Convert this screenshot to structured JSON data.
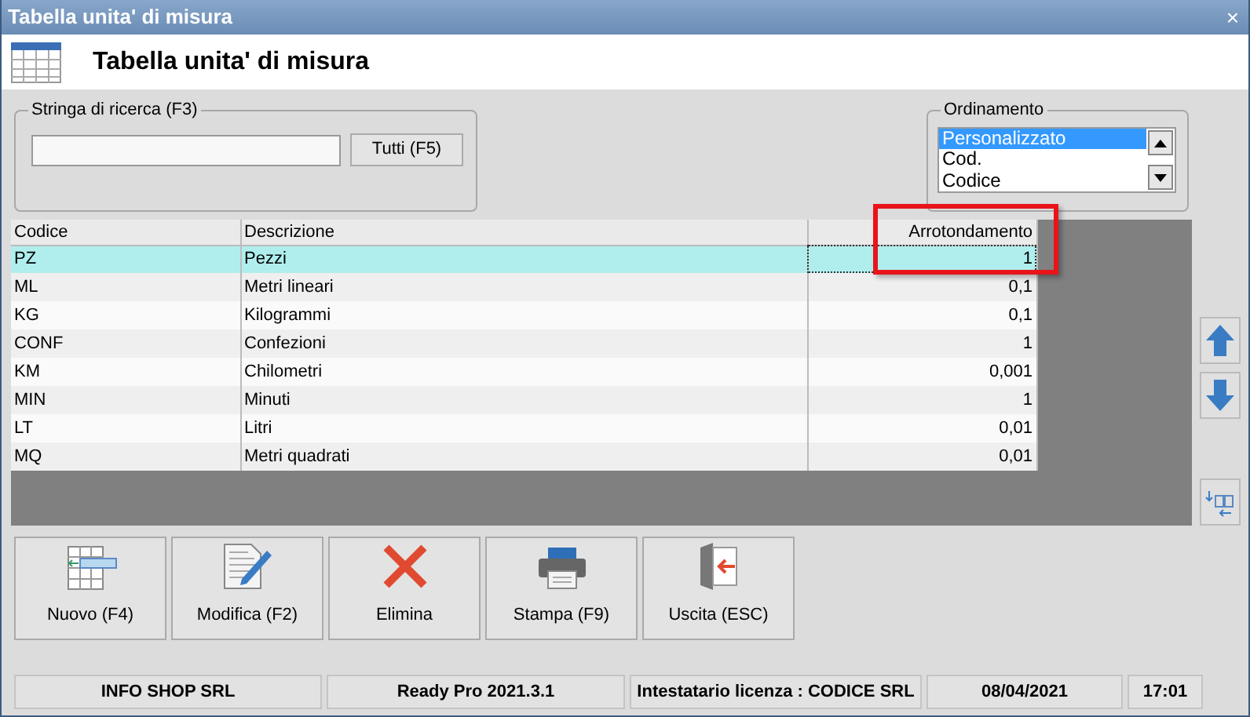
{
  "window": {
    "title": "Tabella unita' di misura",
    "close": "×"
  },
  "header": {
    "title": "Tabella unita' di misura"
  },
  "search": {
    "legend": "Stringa di ricerca (F3)",
    "button": "Tutti (F5)"
  },
  "ordering": {
    "legend": "Ordinamento",
    "options": [
      {
        "label": "Personalizzato",
        "selected": true
      },
      {
        "label": "Cod.",
        "selected": false
      },
      {
        "label": "Codice",
        "selected": false
      }
    ]
  },
  "table": {
    "columns": [
      "Codice",
      "Descrizione",
      "Arrotondamento"
    ],
    "rows": [
      {
        "cells": [
          "PZ",
          "Pezzi",
          "1"
        ],
        "selected": true
      },
      {
        "cells": [
          "ML",
          "Metri lineari",
          "0,1"
        ],
        "selected": false
      },
      {
        "cells": [
          "KG",
          "Kilogrammi",
          "0,1"
        ],
        "selected": false
      },
      {
        "cells": [
          "CONF",
          "Confezioni",
          "1"
        ],
        "selected": false
      },
      {
        "cells": [
          "KM",
          "Chilometri",
          "0,001"
        ],
        "selected": false
      },
      {
        "cells": [
          "MIN",
          "Minuti",
          "1"
        ],
        "selected": false
      },
      {
        "cells": [
          "LT",
          "Litri",
          "0,01"
        ],
        "selected": false
      },
      {
        "cells": [
          "MQ",
          "Metri quadrati",
          "0,01"
        ],
        "selected": false
      }
    ]
  },
  "toolbar": [
    {
      "label": "Nuovo (F4)",
      "kind": "new"
    },
    {
      "label": "Modifica (F2)",
      "kind": "edit"
    },
    {
      "label": "Elimina",
      "kind": "delete"
    },
    {
      "label": "Stampa (F9)",
      "kind": "print"
    },
    {
      "label": "Uscita (ESC)",
      "kind": "exit"
    }
  ],
  "status_bar": [
    "INFO SHOP SRL",
    "Ready Pro 2021.3.1",
    "Intestatario licenza : CODICE SRL",
    "08/04/2021",
    "17:01"
  ]
}
